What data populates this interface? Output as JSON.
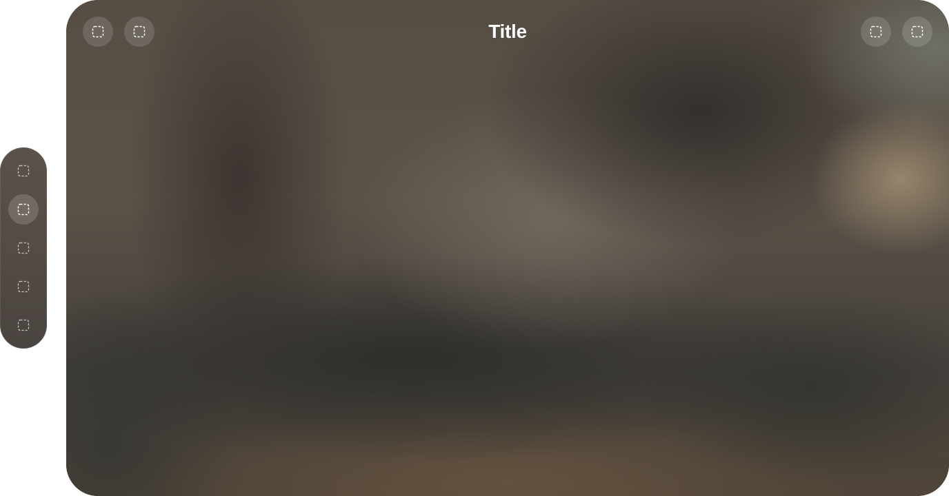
{
  "window": {
    "title": "Title"
  },
  "toolbar": {
    "leading": [
      {
        "icon": "dashed-square-icon"
      },
      {
        "icon": "dashed-square-icon"
      }
    ],
    "trailing": [
      {
        "icon": "dashed-square-icon"
      },
      {
        "icon": "dashed-square-icon"
      }
    ]
  },
  "tabbar": {
    "selected_index": 1,
    "items": [
      {
        "icon": "dashed-square-icon"
      },
      {
        "icon": "dashed-square-icon"
      },
      {
        "icon": "dashed-square-icon"
      },
      {
        "icon": "dashed-square-icon"
      },
      {
        "icon": "dashed-square-icon"
      }
    ]
  },
  "colors": {
    "icon": "#ffffff",
    "title_text": "#ffffff"
  }
}
